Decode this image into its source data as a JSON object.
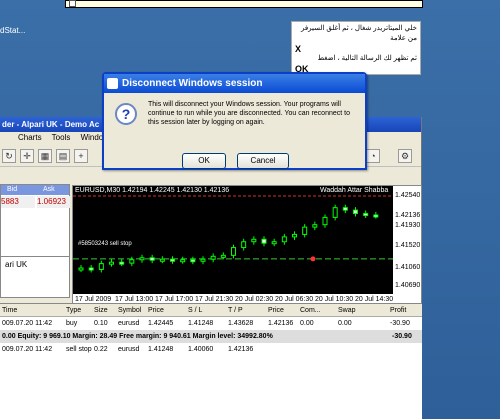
{
  "desktop": {
    "icon_label": "dStat..."
  },
  "arabic_note": {
    "line1": "خلي الميتاتريدر شغال ، ثم أغلق السيرفر من علامة",
    "line2": "X",
    "line3": "ثم تظهر لك الرسالة التالية ، اضغط",
    "line4": "OK"
  },
  "mt4": {
    "title": "der - Alpari UK - Demo Ac",
    "menu": [
      "Charts",
      "Tools",
      "Windo"
    ],
    "market_watch": {
      "col_bid": "Bid",
      "col_ask": "Ask",
      "bid": "5883",
      "ask": "1.06923"
    },
    "navigator": {
      "item": "ari UK"
    },
    "chart": {
      "title": "EURUSD,M30  1.42194 1.42245 1.42130 1.42136",
      "watermark": "Waddah Attar Shabba",
      "sell_label": "#58503243 sell stop",
      "x_labels": [
        "17 Jul 2009",
        "17 Jul 13:00",
        "17 Jul 17:00",
        "17 Jul 21:30",
        "20 Jul 02:30",
        "20 Jul 06:30",
        "20 Jul 10:30",
        "20 Jul 14:30"
      ],
      "y_labels": [
        "1.42540",
        "1.42136",
        "1.41930",
        "1.41520",
        "1.41060",
        "1.40690"
      ],
      "price_line": "1.42136",
      "series": [
        1.4106,
        1.4103,
        1.4115,
        1.4118,
        1.4116,
        1.4123,
        1.4127,
        1.4122,
        1.4124,
        1.4121,
        1.4123,
        1.412,
        1.4124,
        1.413,
        1.4132,
        1.4148,
        1.416,
        1.4165,
        1.4157,
        1.416,
        1.417,
        1.4175,
        1.419,
        1.4195,
        1.421,
        1.423,
        1.4225,
        1.4218,
        1.4215,
        1.42136
      ]
    },
    "terminal": {
      "headers": [
        "Time",
        "Type",
        "Size",
        "Symbol",
        "Price",
        "S / L",
        "T / P",
        "Price",
        "Com...",
        "Swap",
        "Profit"
      ],
      "row1": [
        "009.07.20 11:42",
        "buy",
        "0.10",
        "eurusd",
        "1.42445",
        "1.41248",
        "1.43628",
        "1.42136",
        "0.00",
        "0.00",
        "-30.90"
      ],
      "summary": "0.00  Equity: 9 969.10  Margin: 28.49  Free margin: 9 940.61  Margin level: 34992.80%",
      "summary_profit": "-30.90",
      "row2": [
        "009.07.20 11:42",
        "sell stop",
        "0.22",
        "eurusd",
        "1.41248",
        "1.40060",
        "1.42136"
      ]
    }
  },
  "dialog": {
    "title": "Disconnect Windows session",
    "message": "This will disconnect your Windows session. Your programs will continue to run while you are disconnected. You can reconnect to this session later by logging on again.",
    "ok_label": "OK",
    "cancel_label": "Cancel"
  },
  "colors": {
    "desktop": "#3a6ea5",
    "titlebar": "#0b4bd4",
    "quote_red": "#c00000"
  }
}
